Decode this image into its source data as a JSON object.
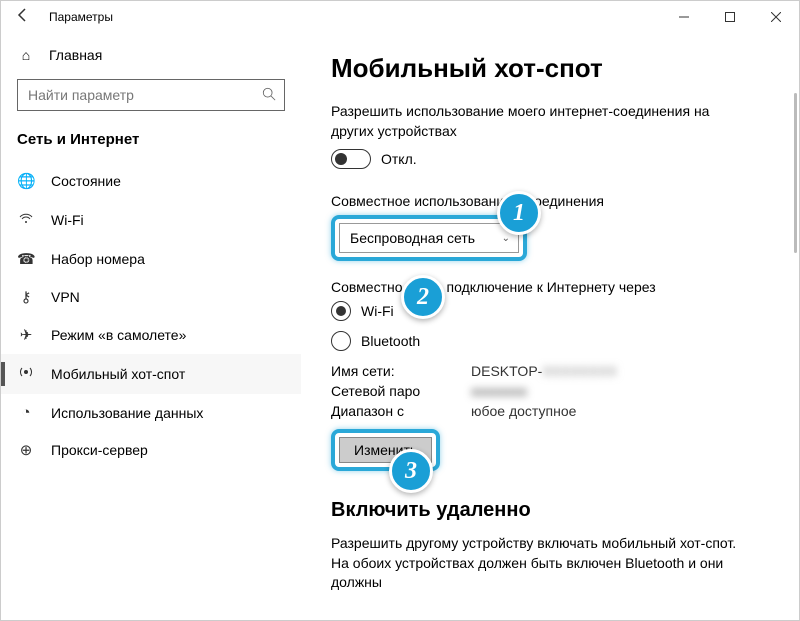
{
  "titlebar": {
    "title": "Параметры"
  },
  "sidebar": {
    "home_label": "Главная",
    "search_placeholder": "Найти параметр",
    "section": "Сеть и Интернет",
    "items": [
      {
        "icon": "🌐",
        "label": "Состояние"
      },
      {
        "icon": "⟳",
        "label": "Wi-Fi"
      },
      {
        "icon": "☎",
        "label": "Набор номера"
      },
      {
        "icon": "⚷",
        "label": "VPN"
      },
      {
        "icon": "✈",
        "label": "Режим «в самолете»"
      },
      {
        "icon": "⟳",
        "label": "Мобильный хот-спот"
      },
      {
        "icon": "◔",
        "label": "Использование данных"
      },
      {
        "icon": "⊕",
        "label": "Прокси-сервер"
      }
    ]
  },
  "main": {
    "heading": "Мобильный хот-спот",
    "share_desc": "Разрешить использование моего интернет-соединения на других устройствах",
    "toggle_label": "Откл.",
    "share_from_label": "Совместное использование                   т-соединения",
    "dropdown_value": "Беспроводная сеть",
    "share_via_label": "Совместно                 овать подключение к Интернету через",
    "radio_wifi": "Wi-Fi",
    "radio_bluetooth": "Bluetooth",
    "net_name_label": "Имя сети:",
    "net_name_value": "DESKTOP-",
    "net_pass_label": "Сетевой паро",
    "net_band_label": "Диапазон с",
    "net_band_value": "юбое доступное",
    "edit_button": "Изменить",
    "remote_heading": "Включить удаленно",
    "remote_desc": "Разрешить другому устройству включать мобильный хот-спот. На обоих устройствах должен быть включен Bluetooth и они должны"
  },
  "annotations": {
    "badge1": "1",
    "badge2": "2",
    "badge3": "3"
  }
}
